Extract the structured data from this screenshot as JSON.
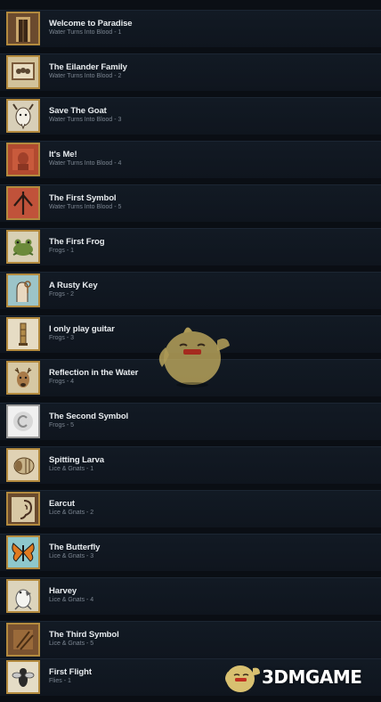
{
  "achievements": [
    {
      "title": "Welcome to Paradise",
      "subtitle": "Water Turns Into Blood - 1",
      "icon": "doorway-icon"
    },
    {
      "title": "The Eilander Family",
      "subtitle": "Water Turns Into Blood - 2",
      "icon": "family-portrait-icon"
    },
    {
      "title": "Save The Goat",
      "subtitle": "Water Turns Into Blood - 3",
      "icon": "goat-icon"
    },
    {
      "title": "It's Me!",
      "subtitle": "Water Turns Into Blood - 4",
      "icon": "red-portrait-icon"
    },
    {
      "title": "The First Symbol",
      "subtitle": "Water Turns Into Blood - 5",
      "icon": "symbol-icon"
    },
    {
      "title": "The First Frog",
      "subtitle": "Frogs - 1",
      "icon": "frog-icon"
    },
    {
      "title": "A Rusty Key",
      "subtitle": "Frogs - 2",
      "icon": "hand-key-icon"
    },
    {
      "title": "I only play guitar",
      "subtitle": "Frogs - 3",
      "icon": "tower-icon"
    },
    {
      "title": "Reflection in the Water",
      "subtitle": "Frogs - 4",
      "icon": "deer-icon"
    },
    {
      "title": "The Second Symbol",
      "subtitle": "Frogs - 5",
      "icon": "swirl-symbol-icon"
    },
    {
      "title": "Spitting Larva",
      "subtitle": "Lice & Gnats - 1",
      "icon": "larva-icon"
    },
    {
      "title": "Earcut",
      "subtitle": "Lice & Gnats - 2",
      "icon": "ear-icon"
    },
    {
      "title": "The Butterfly",
      "subtitle": "Lice & Gnats - 3",
      "icon": "butterfly-icon"
    },
    {
      "title": "Harvey",
      "subtitle": "Lice & Gnats - 4",
      "icon": "parrot-icon"
    },
    {
      "title": "The Third Symbol",
      "subtitle": "Lice & Gnats - 5",
      "icon": "wood-symbol-icon"
    },
    {
      "title": "First Flight",
      "subtitle": "Flies - 1",
      "icon": "fly-icon"
    }
  ],
  "watermark": {
    "text": "3DMGAME"
  },
  "colors": {
    "row_bg": "#121a24",
    "page_bg": "#0b0f15",
    "title": "#e8ecef",
    "subtitle": "#7b8591",
    "frame": "#b38a3e"
  }
}
